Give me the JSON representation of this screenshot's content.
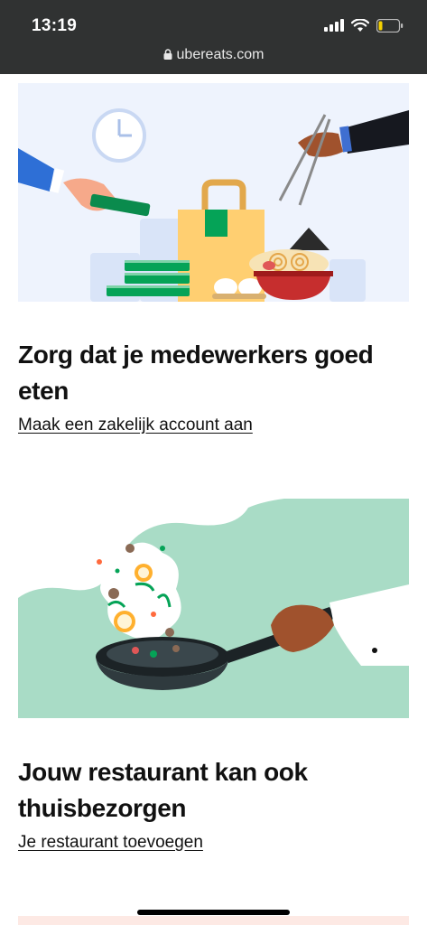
{
  "status_bar": {
    "time": "13:19",
    "url": "ubereats.com",
    "icons": [
      "signal-icon",
      "wifi-icon",
      "battery-icon"
    ]
  },
  "cards": [
    {
      "illustration": "food-delivery-illustration",
      "title": "Zorg dat je medewerkers goed eten",
      "link": "Maak een zakelijk account aan"
    },
    {
      "illustration": "cooking-pan-illustration",
      "title": "Jouw restaurant kan ook thuisbezorgen",
      "link": "Je restaurant toevoegen"
    }
  ],
  "colors": {
    "status_bar_bg": "#303232",
    "illustration1_bg": "#eef3fd",
    "illustration2_bg": "#a9dcc6",
    "text": "#111111"
  }
}
